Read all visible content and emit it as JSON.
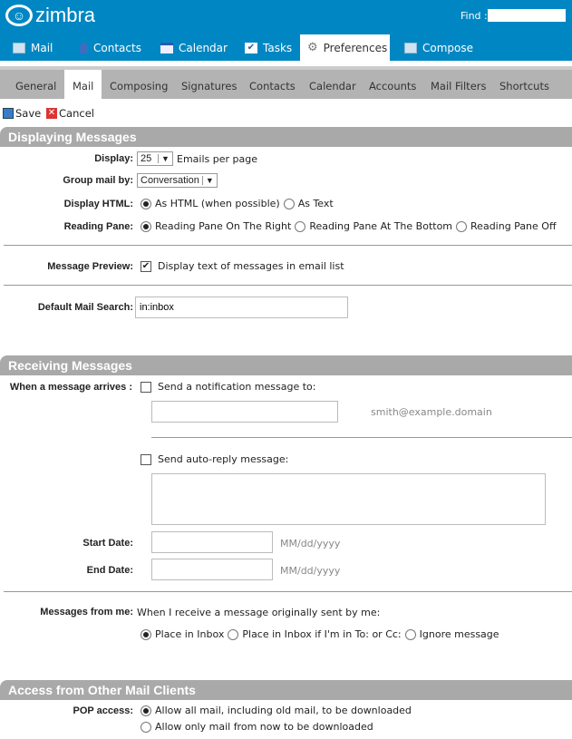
{
  "header": {
    "logo": "zimbra",
    "find_label": "Find :",
    "find_value": ""
  },
  "nav": [
    {
      "label": "Mail",
      "icon": "envelope-icon"
    },
    {
      "label": "Contacts",
      "icon": "person-icon"
    },
    {
      "label": "Calendar",
      "icon": "calendar-icon"
    },
    {
      "label": "Tasks",
      "icon": "checkbox-icon"
    },
    {
      "label": "Preferences",
      "icon": "gear-icon",
      "selected": true
    },
    {
      "label": "Compose",
      "icon": "compose-icon"
    }
  ],
  "subtabs": [
    "General",
    "Mail",
    "Composing",
    "Signatures",
    "Contacts",
    "Calendar",
    "Accounts",
    "Mail Filters",
    "Shortcuts"
  ],
  "toolbar": {
    "save": "Save",
    "cancel": "Cancel"
  },
  "displaying": {
    "title": "Displaying Messages",
    "display_label": "Display:",
    "display_value": "25",
    "display_suffix": "Emails per page",
    "group_label": "Group mail by:",
    "group_value": "Conversation",
    "html_label": "Display HTML:",
    "html_opt1": "As HTML (when possible)",
    "html_opt2": "As Text",
    "pane_label": "Reading Pane:",
    "pane_opt1": "Reading Pane On The Right",
    "pane_opt2": "Reading Pane At The Bottom",
    "pane_opt3": "Reading Pane Off",
    "preview_label": "Message Preview:",
    "preview_text": "Display text of messages in email list",
    "preview_checked": true,
    "search_label": "Default Mail Search:",
    "search_value": "in:inbox"
  },
  "receiving": {
    "title": "Receiving Messages",
    "arrives_label": "When a message arrives :",
    "notify_text": "Send a notification message to:",
    "notify_hint": "smith@example.domain",
    "autoreply_text": "Send auto-reply message:",
    "start_label": "Start Date:",
    "end_label": "End Date:",
    "date_hint": "MM/dd/yyyy",
    "fromme_label": "Messages from me:",
    "fromme_text": "When I receive a message originally sent by me:",
    "fromme_opt1": "Place in Inbox",
    "fromme_opt2": "Place in Inbox if I'm in To: or Cc:",
    "fromme_opt3": "Ignore message"
  },
  "access": {
    "title": "Access from Other Mail Clients",
    "pop_label": "POP access:",
    "pop_opt1": "Allow all mail, including old mail, to be downloaded",
    "pop_opt2": "Allow only mail from now to be downloaded"
  }
}
